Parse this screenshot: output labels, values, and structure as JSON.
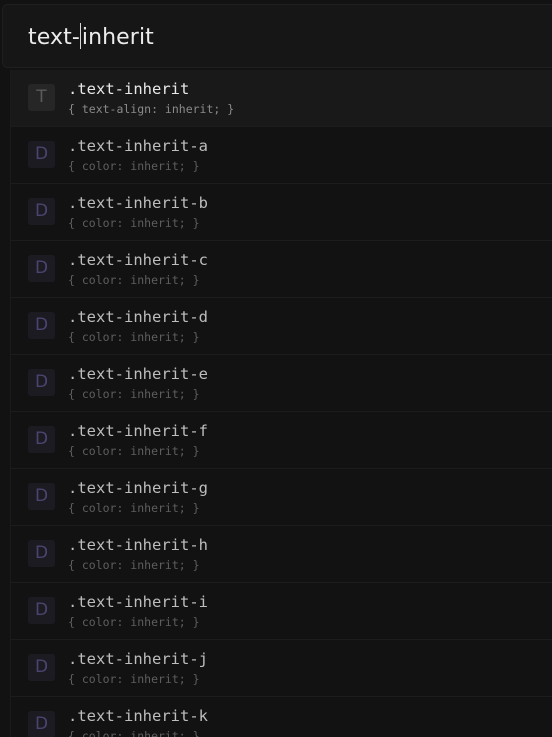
{
  "search": {
    "text_before_caret": "text-",
    "text_after_caret": "inherit"
  },
  "results": [
    {
      "badge": "T",
      "name": ".text-inherit",
      "desc": "{ text-align: inherit; }",
      "selected": true
    },
    {
      "badge": "D",
      "name": ".text-inherit-a",
      "desc": "{ color: inherit; }"
    },
    {
      "badge": "D",
      "name": ".text-inherit-b",
      "desc": "{ color: inherit; }"
    },
    {
      "badge": "D",
      "name": ".text-inherit-c",
      "desc": "{ color: inherit; }"
    },
    {
      "badge": "D",
      "name": ".text-inherit-d",
      "desc": "{ color: inherit; }"
    },
    {
      "badge": "D",
      "name": ".text-inherit-e",
      "desc": "{ color: inherit; }"
    },
    {
      "badge": "D",
      "name": ".text-inherit-f",
      "desc": "{ color: inherit; }"
    },
    {
      "badge": "D",
      "name": ".text-inherit-g",
      "desc": "{ color: inherit; }"
    },
    {
      "badge": "D",
      "name": ".text-inherit-h",
      "desc": "{ color: inherit; }"
    },
    {
      "badge": "D",
      "name": ".text-inherit-i",
      "desc": "{ color: inherit; }"
    },
    {
      "badge": "D",
      "name": ".text-inherit-j",
      "desc": "{ color: inherit; }"
    },
    {
      "badge": "D",
      "name": ".text-inherit-k",
      "desc": "{ color: inherit; }"
    }
  ],
  "colors": {
    "background": "#121212",
    "badge_purple": "#4b4470",
    "text_primary": "#e8e8e8",
    "text_muted": "#5e5e5e"
  }
}
